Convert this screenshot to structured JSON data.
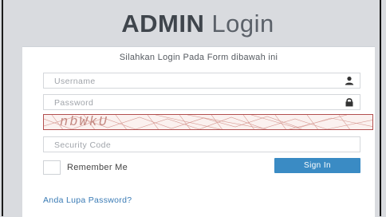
{
  "header": {
    "title_bold": "ADMIN",
    "title_light": "Login"
  },
  "form": {
    "lead_text": "Silahkan Login Pada Form dibawah ini",
    "username_placeholder": "Username",
    "username_icon": "user-icon",
    "password_placeholder": "Password",
    "password_icon": "lock-icon",
    "captcha_text": "nbWkU",
    "security_placeholder": "Security Code",
    "remember_label": "Remember Me",
    "signin_label": "Sign In",
    "forgot_link": "Anda Lupa Password?"
  },
  "colors": {
    "background": "#d9dbdf",
    "button": "#3a8bc4",
    "link": "#3a7bb5",
    "captcha_border": "#b24f4f"
  }
}
